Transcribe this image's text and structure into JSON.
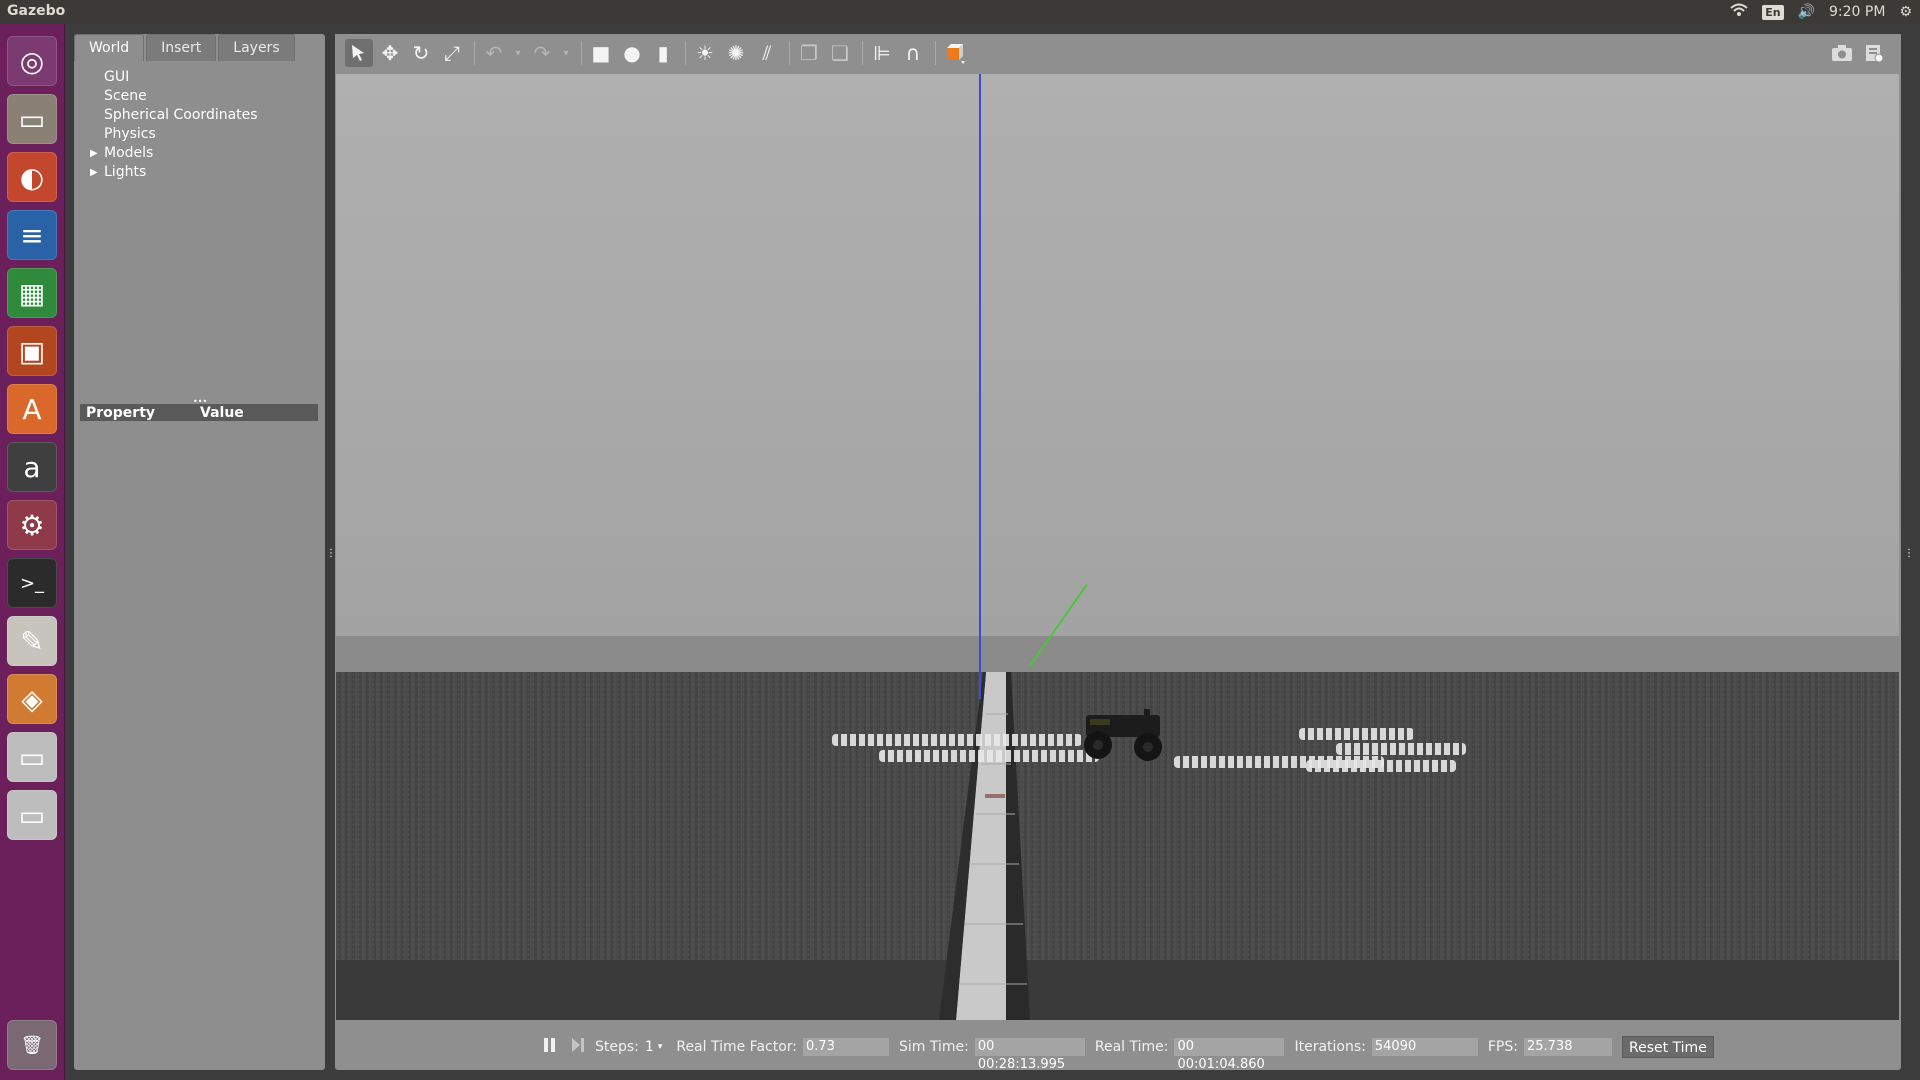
{
  "top_panel": {
    "app_title": "Gazebo",
    "language": "En",
    "clock": "9:20 PM",
    "icons": [
      "wifi-icon",
      "language-indicator",
      "volume-icon",
      "gear-icon"
    ]
  },
  "launcher": {
    "items": [
      {
        "name": "dash-home",
        "glyph": "◎",
        "bg": "#7b3a70"
      },
      {
        "name": "files",
        "glyph": "▭",
        "bg": "#8a8174"
      },
      {
        "name": "firefox",
        "glyph": "◐",
        "bg": "#c3472d"
      },
      {
        "name": "libreoffice-writer",
        "glyph": "≡",
        "bg": "#2a62a8"
      },
      {
        "name": "libreoffice-calc",
        "glyph": "▦",
        "bg": "#2f8a3c"
      },
      {
        "name": "libreoffice-impress",
        "glyph": "▣",
        "bg": "#b3461f"
      },
      {
        "name": "software-center",
        "glyph": "A",
        "bg": "#d9682a"
      },
      {
        "name": "amazon",
        "glyph": "a",
        "bg": "#3f3f3f"
      },
      {
        "name": "system-settings",
        "glyph": "⚙",
        "bg": "#8e3a49"
      },
      {
        "name": "terminal",
        "glyph": ">_",
        "bg": "#2b2b2b"
      },
      {
        "name": "text-editor",
        "glyph": "✎",
        "bg": "#c7c4bd"
      },
      {
        "name": "gazebo",
        "glyph": "◈",
        "bg": "#d17a32"
      },
      {
        "name": "drive-1",
        "glyph": "▭",
        "bg": "#bdbdbd"
      },
      {
        "name": "drive-2",
        "glyph": "▭",
        "bg": "#bdbdbd"
      },
      {
        "name": "trash",
        "glyph": "🗑",
        "bg": "#7a6872"
      }
    ]
  },
  "left_panel": {
    "tabs": [
      "World",
      "Insert",
      "Layers"
    ],
    "tree": [
      {
        "label": "GUI",
        "expandable": false
      },
      {
        "label": "Scene",
        "expandable": false
      },
      {
        "label": "Spherical Coordinates",
        "expandable": false
      },
      {
        "label": "Physics",
        "expandable": false
      },
      {
        "label": "Models",
        "expandable": true
      },
      {
        "label": "Lights",
        "expandable": true
      }
    ],
    "property_header": {
      "property": "Property",
      "value": "Value"
    }
  },
  "toolbar": {
    "buttons": [
      "select-mode-icon",
      "translate-mode-icon",
      "rotate-mode-icon",
      "scale-mode-icon",
      "undo-icon",
      "undo-dropdown-icon",
      "redo-icon",
      "redo-dropdown-icon",
      "box-icon",
      "sphere-icon",
      "cylinder-icon",
      "point-light-icon",
      "spot-light-icon",
      "directional-light-icon",
      "copy-icon",
      "paste-icon",
      "align-icon",
      "snap-icon",
      "view-angle-icon",
      "screenshot-icon",
      "record-icon"
    ]
  },
  "status_bar": {
    "steps_label": "Steps:",
    "steps_value": "1",
    "rtf_label": "Real Time Factor:",
    "rtf_value": "0.73",
    "sim_time_label": "Sim Time:",
    "sim_time_value": "00 00:28:13.995",
    "real_time_label": "Real Time:",
    "real_time_value": "00 00:01:04.860",
    "iterations_label": "Iterations:",
    "iterations_value": "54090",
    "fps_label": "FPS:",
    "fps_value": "25.738",
    "reset_label": "Reset Time"
  },
  "colors": {
    "launcher_bg": "#6b1f5b",
    "panel_bg": "#8e8e8e",
    "z_axis": "#3a4bd8",
    "y_axis": "#4cc63c"
  }
}
